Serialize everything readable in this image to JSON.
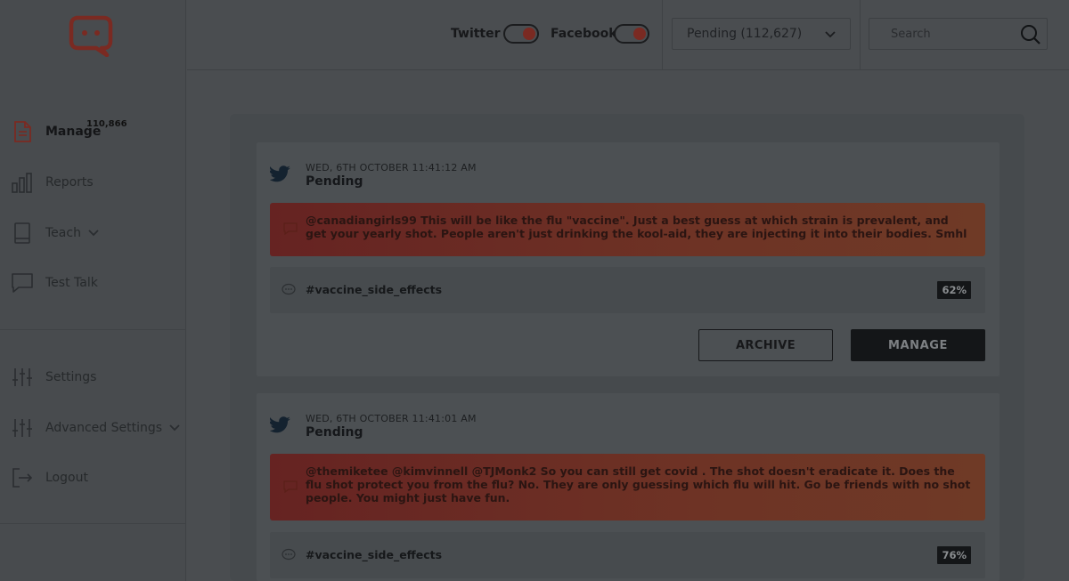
{
  "app": {
    "brand_color": "#7a2a22"
  },
  "sidebar": {
    "manage_count": "110,866",
    "items": [
      {
        "label": "Manage",
        "icon": "document-icon"
      },
      {
        "label": "Reports",
        "icon": "bar-chart-icon"
      },
      {
        "label": "Teach",
        "icon": "book-icon"
      },
      {
        "label": "Test Talk",
        "icon": "chat-bubble-icon"
      },
      {
        "label": "Settings",
        "icon": "sliders-icon"
      },
      {
        "label": "Advanced Settings",
        "icon": "sliders-icon"
      },
      {
        "label": "Logout",
        "icon": "logout-icon"
      }
    ]
  },
  "header": {
    "twitter_label": "Twitter",
    "facebook_label": "Facebook",
    "twitter_on": true,
    "facebook_on": true,
    "status_select": "Pending (112,627)",
    "search_placeholder": "Search"
  },
  "posts": [
    {
      "date": "WED, 6TH OCTOBER 11:41:12 AM",
      "status": "Pending",
      "message": "@canadiangirls99 This will be like the flu \"vaccine\". Just a best guess at which strain is prevalent, and get your yearly shot. People aren't just drinking the kool-aid, they are injecting it into their bodies. Smhl",
      "tag": "#vaccine_side_effects",
      "confidence": "62%",
      "archive_label": "ARCHIVE",
      "manage_label": "MANAGE"
    },
    {
      "date": "WED, 6TH OCTOBER 11:41:01 AM",
      "status": "Pending",
      "message": "@themiketee @kimvinnell @TJMonk2 So you can still get covid . The shot doesn't eradicate it. Does the flu shot protect you from the flu? No. They are only guessing which flu will hit. Go be friends with no shot people. You might just have fun.",
      "tag": "#vaccine_side_effects",
      "confidence": "76%"
    }
  ]
}
